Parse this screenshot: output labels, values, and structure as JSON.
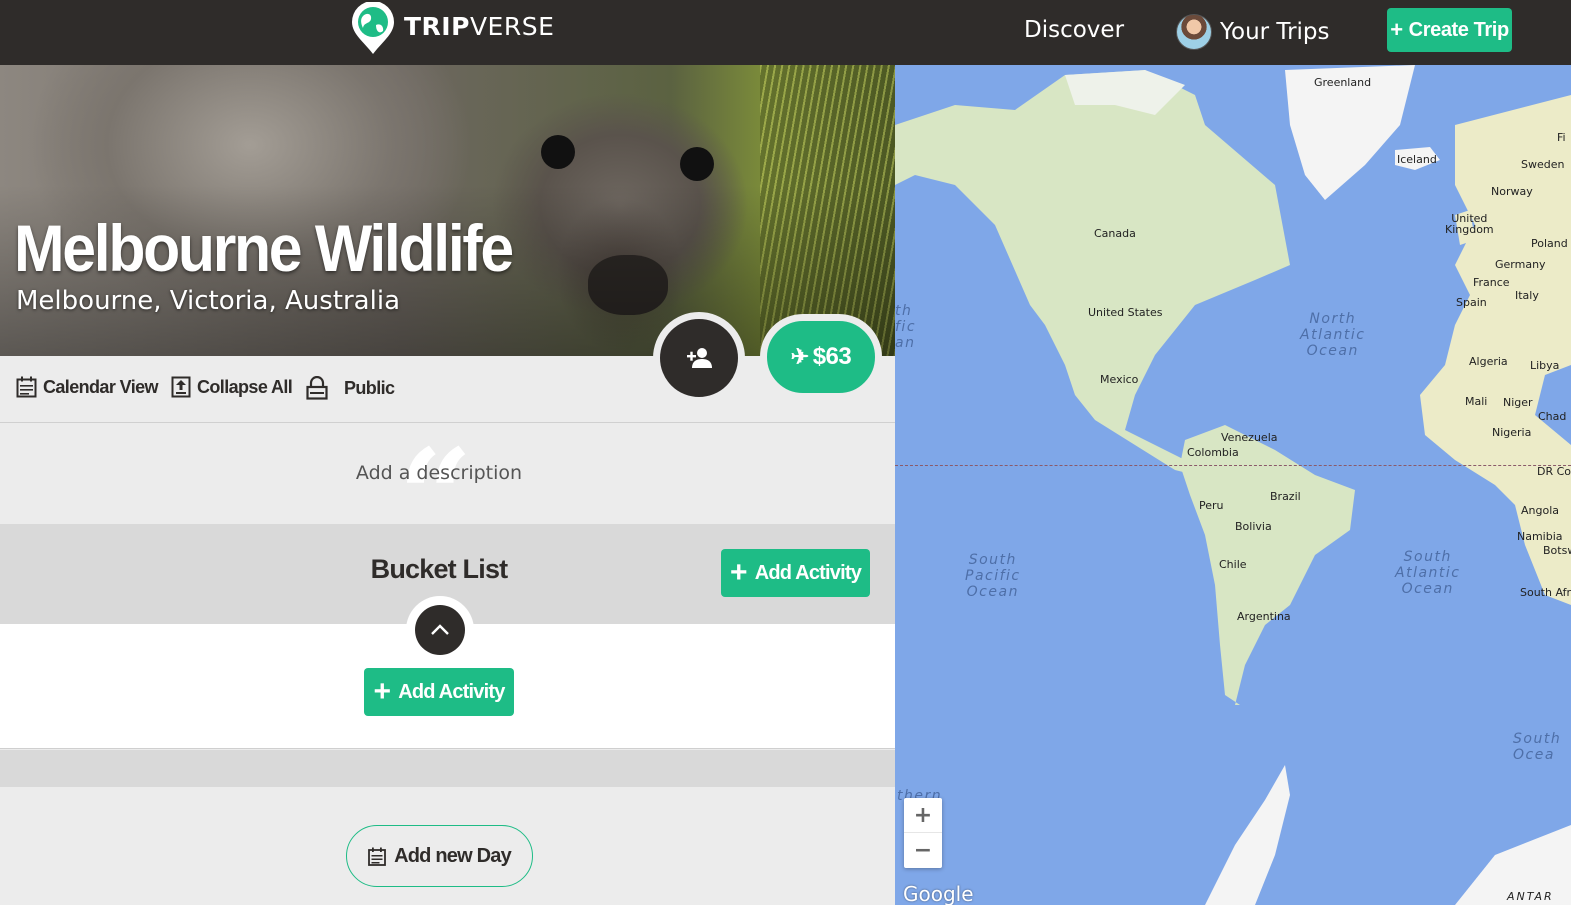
{
  "header": {
    "brand_bold": "TRIP",
    "brand_light": "VERSE",
    "nav_discover": "Discover",
    "nav_your_trips": "Your Trips",
    "create_trip": "Create Trip",
    "create_trip_icon": "+",
    "accent_color": "#1ebc86",
    "bar_color": "#2f2c2a"
  },
  "trip": {
    "title": "Melbourne Wildlife",
    "location": "Melbourne, Victoria, Australia",
    "price": "$63",
    "price_icon": "airplane-icon",
    "invite_icon": "person-add-icon"
  },
  "toolbar": {
    "calendar_view": "Calendar View",
    "collapse_all": "Collapse All",
    "visibility": "Public"
  },
  "description": {
    "placeholder": "Add a description",
    "quote_glyph": "“"
  },
  "bucket_list": {
    "title": "Bucket List",
    "add_activity_header": "Add Activity",
    "add_activity_body": "Add Activity",
    "plus_glyph": "+"
  },
  "add_day": "Add new Day",
  "map": {
    "labels": {
      "greenland": "Greenland",
      "iceland": "Iceland",
      "sweden": "Sweden",
      "norway": "Norway",
      "fi": "Fi",
      "uk": "United\nKingdom",
      "poland": "Poland",
      "germany": "Germany",
      "france": "France",
      "italy": "Italy",
      "spain": "Spain",
      "algeria": "Algeria",
      "libya": "Libya",
      "mali": "Mali",
      "niger": "Niger",
      "chad": "Chad",
      "nigeria": "Nigeria",
      "drc": "DR Co",
      "angola": "Angola",
      "namibia": "Namibia",
      "bots": "Botsw",
      "south_africa": "South Afr",
      "canada": "Canada",
      "united_states": "United States",
      "mexico": "Mexico",
      "venezuela": "Venezuela",
      "colombia": "Colombia",
      "peru": "Peru",
      "brazil": "Brazil",
      "bolivia": "Bolivia",
      "chile": "Chile",
      "argentina": "Argentina",
      "antarctica": "ANTAR"
    },
    "oceans": {
      "north_atlantic": "North\nAtlantic\nOcean",
      "south_atlantic": "South\nAtlantic\nOcean",
      "south_pacific": "South\nPacific\nOcean",
      "north_pacific_partial": "th\nfic\nan",
      "southern_partial": "South\nOcea",
      "southern_left_partial": "thern"
    },
    "zoom_in": "+",
    "zoom_out": "−",
    "attribution": "Google",
    "water_color": "#7fa7e8",
    "land_color": "#d8e6c4"
  }
}
